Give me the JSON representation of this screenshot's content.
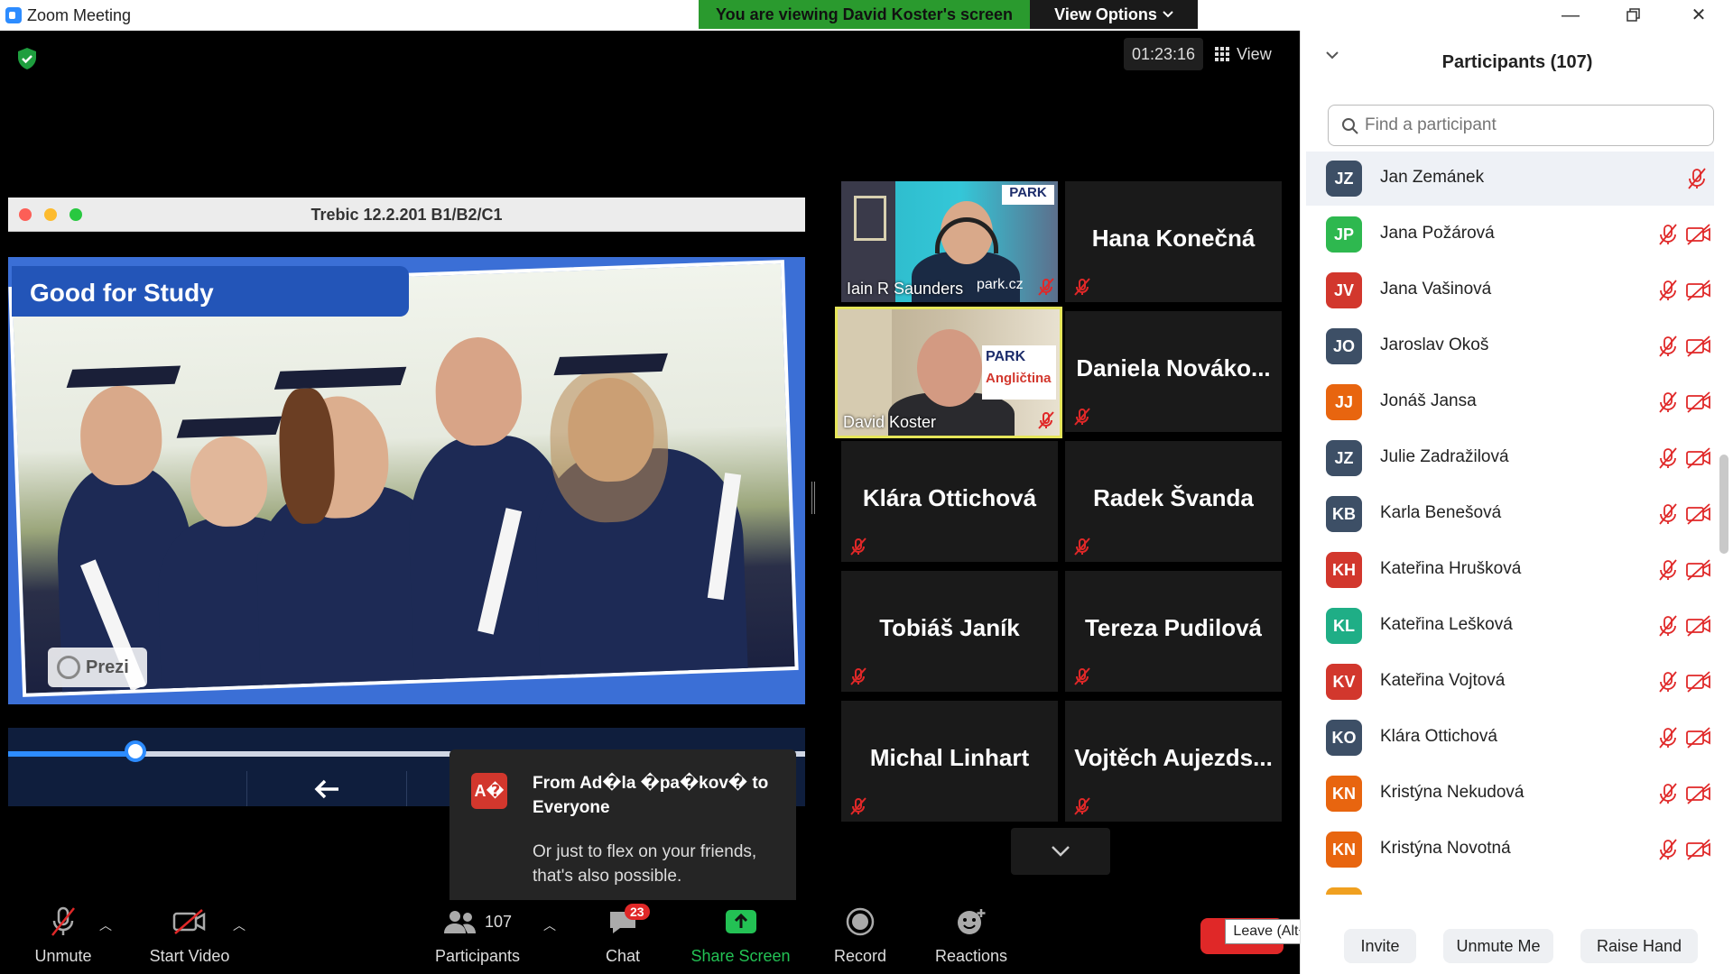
{
  "window": {
    "title": "Zoom Meeting",
    "viewing_banner": "You are viewing David Koster's screen",
    "view_options": "View Options"
  },
  "meeting": {
    "timer": "01:23:16",
    "view_label": "View"
  },
  "shared_screen": {
    "window_title": "Trebic 12.2.201 B1/B2/C1",
    "slide_title": "Good for Study",
    "prezi_label": "Prezi",
    "progress_fraction": 0.16
  },
  "gallery": {
    "video_tiles": [
      {
        "name": "Iain R Saunders",
        "sign": "PARK",
        "sign2": "park.cz"
      },
      {
        "name": "David Koster",
        "sign": "PARK",
        "sign2": "Angličtina"
      }
    ],
    "name_tiles": [
      "Hana Konečná",
      "Daniela  Nováko...",
      "Klára Ottichová",
      "Radek Švanda",
      "Tobiáš Janík",
      "Tereza Pudilová",
      "Michal Linhart",
      "Vojtěch  Aujezds..."
    ]
  },
  "chat_popup": {
    "avatar_initials": "A�",
    "from": "From Ad�la �pa�kov� to Everyone",
    "message": "Or just to flex on your friends, that's also possible."
  },
  "toolbar": {
    "unmute": "Unmute",
    "start_video": "Start Video",
    "participants": "Participants",
    "participants_count": "107",
    "chat": "Chat",
    "chat_badge": "23",
    "share_screen": "Share Screen",
    "record": "Record",
    "reactions": "Reactions",
    "leave_tooltip": "Leave (Alt+Q)"
  },
  "participants_panel": {
    "title": "Participants (107)",
    "search_placeholder": "Find a participant",
    "participants": [
      {
        "initials": "JZ",
        "name": "Jan Zemánek",
        "color": "#3d4f66",
        "video_off": false
      },
      {
        "initials": "JP",
        "name": "Jana Požárová",
        "color": "#2eb84f",
        "video_off": true
      },
      {
        "initials": "JV",
        "name": "Jana Vašinová",
        "color": "#d2372d",
        "video_off": true
      },
      {
        "initials": "JO",
        "name": "Jaroslav Okoš",
        "color": "#3d4f66",
        "video_off": true
      },
      {
        "initials": "JJ",
        "name": "Jonáš Jansa",
        "color": "#e8650f",
        "video_off": true
      },
      {
        "initials": "JZ",
        "name": "Julie Zadražilová",
        "color": "#3d4f66",
        "video_off": true
      },
      {
        "initials": "KB",
        "name": "Karla Benešová",
        "color": "#3d4f66",
        "video_off": true
      },
      {
        "initials": "KH",
        "name": "Kateřina Hrušková",
        "color": "#d2372d",
        "video_off": true
      },
      {
        "initials": "KL",
        "name": "Kateřina Lešková",
        "color": "#1fae86",
        "video_off": true
      },
      {
        "initials": "KV",
        "name": "Kateřina Vojtová",
        "color": "#d2372d",
        "video_off": true
      },
      {
        "initials": "KO",
        "name": "Klára Ottichová",
        "color": "#3d4f66",
        "video_off": true
      },
      {
        "initials": "KN",
        "name": "Kristýna Nekudová",
        "color": "#e8650f",
        "video_off": true
      },
      {
        "initials": "KN",
        "name": "Kristýna Novotná",
        "color": "#e8650f",
        "video_off": true
      },
      {
        "initials": "",
        "name": "",
        "color": "#f0a020",
        "video_off": true
      }
    ],
    "invite": "Invite",
    "unmute_me": "Unmute Me",
    "raise_hand": "Raise Hand"
  },
  "colors": {
    "zoom_blue": "#2d8cff",
    "banner_green": "#2a9a2e",
    "muted_red": "#e02828",
    "active_speaker_border": "#e6e65a"
  }
}
